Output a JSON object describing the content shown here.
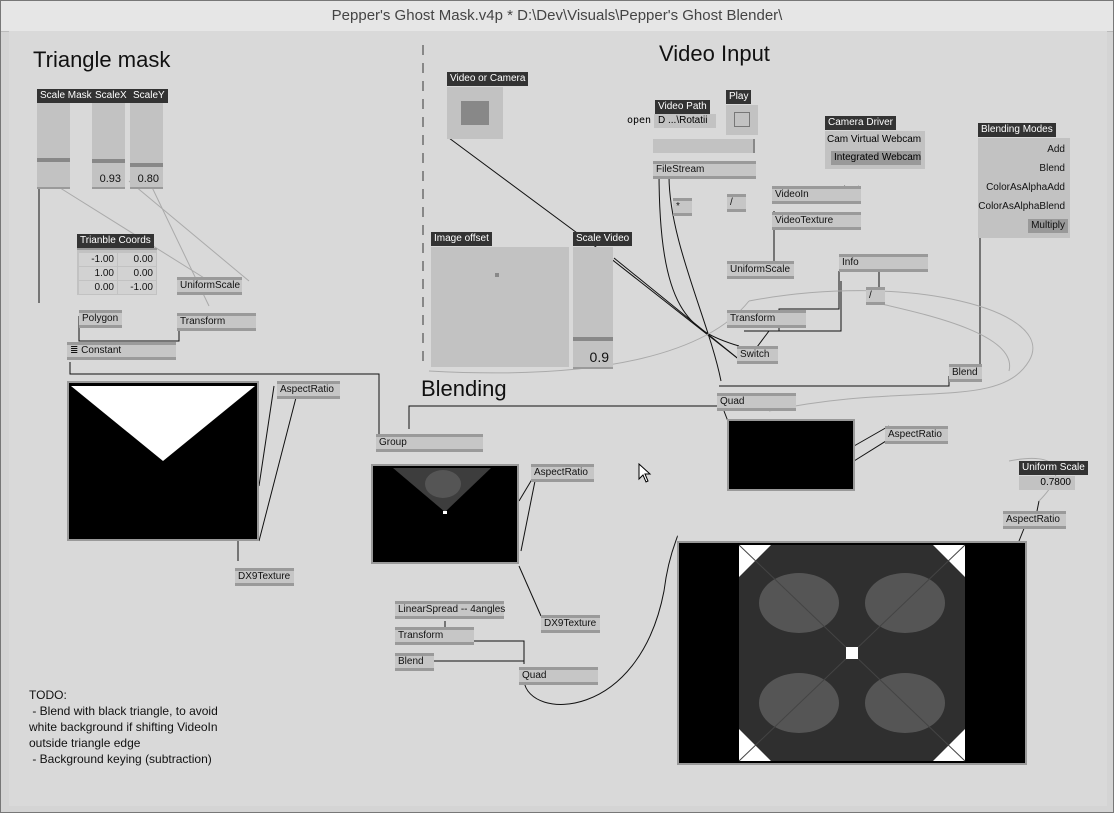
{
  "window": {
    "title": "Pepper's Ghost Mask.v4p *  D:\\Dev\\Visuals\\Pepper's Ghost Blender\\"
  },
  "sections": {
    "triangle_mask": "Triangle mask",
    "video_input": "Video Input",
    "blending": "Blending"
  },
  "sliders": {
    "scale_mask": {
      "label": "Scale Mask",
      "level": 0.5
    },
    "scale_x": {
      "label": "ScaleX",
      "value": "0.93",
      "level": 0.6
    },
    "scale_y": {
      "label": "ScaleY",
      "value": "0.80",
      "level": 0.7
    },
    "scale_video": {
      "label": "Scale Video",
      "value": "0.9",
      "level": 0.9
    }
  },
  "triangle_coords": {
    "label": "Trianble Coords",
    "rows": [
      [
        "-1.00",
        "0.00"
      ],
      [
        "1.00",
        "0.00"
      ],
      [
        "0.00",
        "-1.00"
      ]
    ]
  },
  "nodes": {
    "uniformscale_left": "UniformScale",
    "polygon": "Polygon",
    "transform_left": "Transform",
    "constant": "Constant",
    "aspect_left": "AspectRatio",
    "dx9_left": "DX9Texture",
    "group": "Group",
    "aspect_mid": "AspectRatio",
    "linearspread": "LinearSpread -- 4angles",
    "transform_mid": "Transform",
    "blend_mid": "Blend",
    "dx9_mid": "DX9Texture",
    "quad_mid": "Quad",
    "filestream": "FileStream",
    "multiply": "*",
    "divide": "/",
    "videoin": "VideoIn",
    "videotexture": "VideoTexture",
    "uniformscale_video": "UniformScale",
    "transform_video": "Transform",
    "switch": "Switch",
    "info": "Info",
    "divide2": "/",
    "quad_video": "Quad",
    "blend_video": "Blend",
    "aspect_video": "AspectRatio",
    "aspect_right": "AspectRatio"
  },
  "panels": {
    "video_or_camera": "Video or Camera",
    "video_path": {
      "label": "Video Path",
      "open": "open",
      "path": "D ...\\Rotatii"
    },
    "play": "Play",
    "camera_driver": {
      "label": "Camera Driver",
      "options": [
        "Cam Virtual Webcam",
        "Integrated Webcam"
      ],
      "selected": "Integrated Webcam"
    },
    "blending_modes": {
      "label": "Blending Modes",
      "options": [
        "Add",
        "Blend",
        "ColorAsAlphaAdd",
        "ColorAsAlphaBlend",
        "Multiply"
      ],
      "selected": "Multiply"
    },
    "image_offset": "Image offset",
    "uniform_scale": {
      "label": "Uniform Scale",
      "value": "0.7800"
    }
  },
  "todo": "TODO:\n - Blend with black triangle, to avoid\nwhite background if shifting VideoIn\noutside triangle edge\n - Background keying (subtraction)",
  "colors": {
    "canvas": "#d9d9d9",
    "node": "#c6c6c6",
    "panel_title": "#333333",
    "wire": "#111111"
  }
}
